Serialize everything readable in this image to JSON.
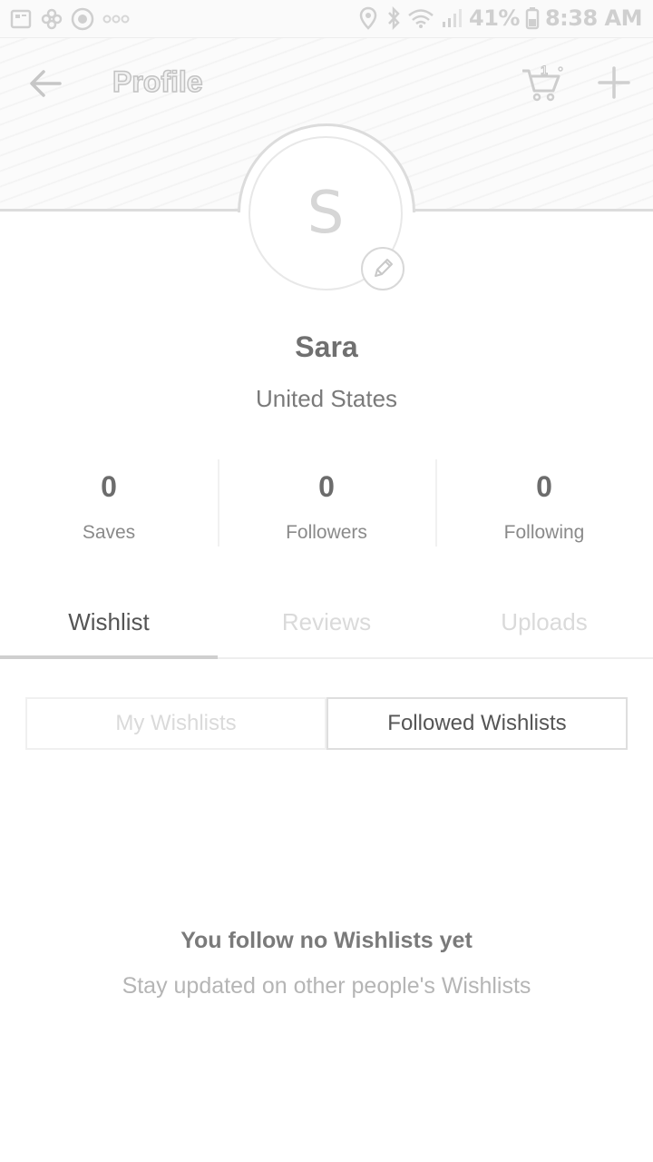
{
  "status_bar": {
    "left_icons": [
      "image-notification-icon",
      "flower-notification-icon",
      "record-notification-icon",
      "more-dots-icon"
    ],
    "right_icons": [
      "location-icon",
      "bluetooth-icon",
      "wifi-icon",
      "signal-icon",
      "battery-icon"
    ],
    "battery": "41%",
    "time": "8:38 AM"
  },
  "header": {
    "title": "Profile",
    "back_icon": "back-arrow-icon",
    "cart_icon": "cart-icon",
    "cart_badge": "1",
    "add_icon": "plus-icon"
  },
  "profile": {
    "avatar_initial": "S",
    "name": "Sara",
    "location": "United States"
  },
  "stats": [
    {
      "value": "0",
      "label": "Saves"
    },
    {
      "value": "0",
      "label": "Followers"
    },
    {
      "value": "0",
      "label": "Following"
    }
  ],
  "tabs": [
    {
      "label": "Wishlist",
      "active": true
    },
    {
      "label": "Reviews",
      "active": false
    },
    {
      "label": "Uploads",
      "active": false
    }
  ],
  "segments": [
    {
      "label": "My Wishlists",
      "active": false
    },
    {
      "label": "Followed Wishlists",
      "active": true
    }
  ],
  "empty_state": {
    "title": "You follow no Wishlists yet",
    "subtitle": "Stay updated on other people's Wishlists"
  }
}
